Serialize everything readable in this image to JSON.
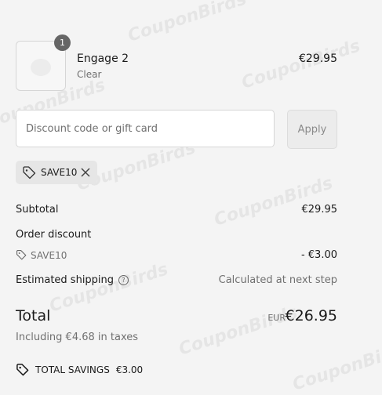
{
  "watermark": "CouponBirds",
  "line_item": {
    "quantity": "1",
    "name": "Engage 2",
    "variant": "Clear",
    "price": "€29.95"
  },
  "discount": {
    "placeholder": "Discount code or gift card",
    "apply_label": "Apply",
    "applied_code": "SAVE10"
  },
  "summary": {
    "subtotal_label": "Subtotal",
    "subtotal_value": "€29.95",
    "order_discount_label": "Order discount",
    "order_discount_code": "SAVE10",
    "order_discount_value": "- €3.00",
    "shipping_label": "Estimated shipping",
    "shipping_value": "Calculated at next step",
    "total_label": "Total",
    "total_currency": "EUR",
    "total_value": "€26.95",
    "taxes_text": "Including €4.68 in taxes",
    "savings_label": "TOTAL SAVINGS",
    "savings_value": "€3.00"
  }
}
